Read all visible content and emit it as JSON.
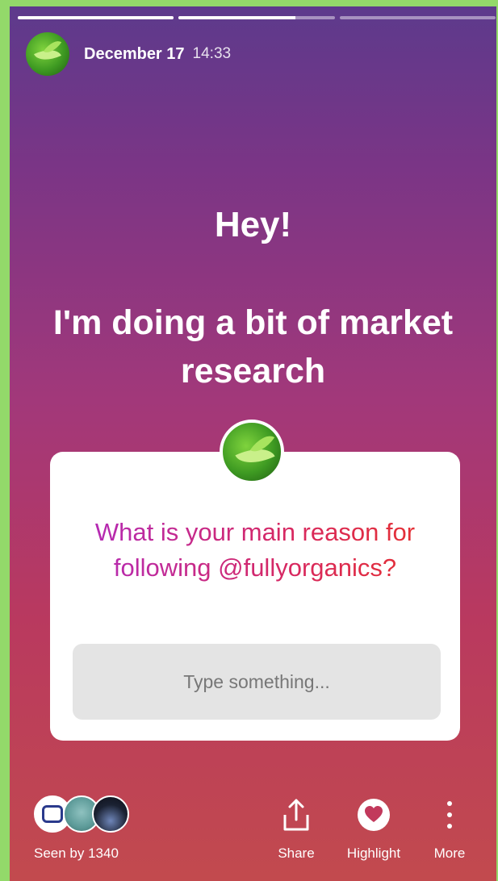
{
  "header": {
    "date": "December 17",
    "time": "14:33"
  },
  "progress": [
    {
      "fill": 1.0
    },
    {
      "fill": 0.75
    },
    {
      "fill": 0.0
    }
  ],
  "story": {
    "greeting": "Hey!",
    "subtitle": "I'm doing a bit of market research"
  },
  "question_sticker": {
    "question": "What is your main reason for following @fullyorganics?",
    "placeholder": "Type something..."
  },
  "footer": {
    "seen_by": "Seen by 1340",
    "share_label": "Share",
    "highlight_label": "Highlight",
    "more_label": "More"
  },
  "colors": {
    "question_gradient_start": "#b02bc0",
    "question_gradient_end": "#e7322c",
    "frame_border": "#93d96a"
  },
  "icons": [
    "share-icon",
    "heart-icon",
    "more-icon"
  ]
}
